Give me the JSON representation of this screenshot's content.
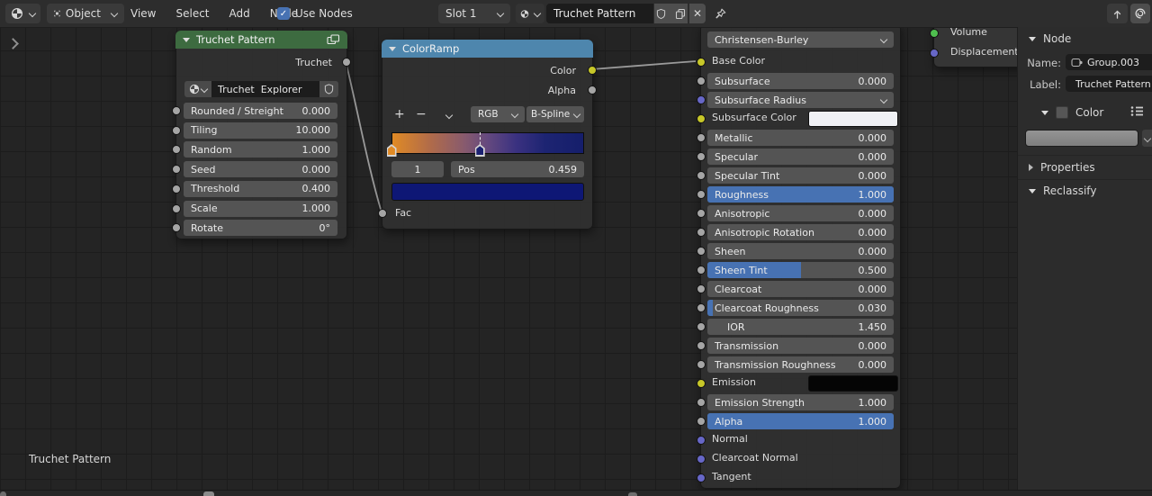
{
  "topbar": {
    "mode": "Object",
    "menus": [
      "View",
      "Select",
      "Add",
      "Node"
    ],
    "use_nodes": "Use Nodes",
    "slot": "Slot 1",
    "material_name": "Truchet Pattern"
  },
  "canvas": {
    "breadcrumb": "Truchet Pattern"
  },
  "truchet_node": {
    "title": "Truchet Pattern",
    "output": "Truchet",
    "datablock": "Truchet  Explorer",
    "params": [
      {
        "label": "Rounded / Streight",
        "value": "0.000"
      },
      {
        "label": "Tiling",
        "value": "10.000"
      },
      {
        "label": "Random",
        "value": "1.000"
      },
      {
        "label": "Seed",
        "value": "0.000"
      },
      {
        "label": "Threshold",
        "value": "0.400"
      },
      {
        "label": "Scale",
        "value": "1.000"
      },
      {
        "label": "Rotate",
        "value": "0°"
      }
    ]
  },
  "colorramp_node": {
    "title": "ColorRamp",
    "output_color": "Color",
    "output_alpha": "Alpha",
    "color_mode": "RGB",
    "interpolation": "B-Spline",
    "active_index": "1",
    "pos_label": "Pos",
    "pos_value": "0.459",
    "input": "Fac",
    "selected_swatch": "#0e1775",
    "gradient_css_stops": [
      "#e08a25 0%",
      "#b06b4a 20%",
      "#875a6e 38%",
      "#64497f 50%",
      "#3a3180 65%",
      "#1d2472 80%",
      "#151e6b 100%"
    ],
    "stops": [
      {
        "pos": 0.0,
        "color": "#e08a25",
        "selected": false
      },
      {
        "pos": 0.459,
        "color": "#1b2171",
        "selected": true
      }
    ]
  },
  "principled_node": {
    "rows": [
      {
        "type": "select",
        "label": "Christensen-Burley"
      },
      {
        "type": "label",
        "label": "Base Color",
        "socket": "yellow"
      },
      {
        "type": "slider",
        "label": "Subsurface",
        "value": "0.000",
        "fill": 0,
        "socket": "gray"
      },
      {
        "type": "select",
        "label": "Subsurface Radius",
        "socket": "vector"
      },
      {
        "type": "color",
        "label": "Subsurface Color",
        "swatch": "#f0f1f5",
        "socket": "yellow"
      },
      {
        "type": "slider",
        "label": "Metallic",
        "value": "0.000",
        "fill": 0,
        "socket": "gray"
      },
      {
        "type": "slider",
        "label": "Specular",
        "value": "0.000",
        "fill": 0,
        "socket": "gray"
      },
      {
        "type": "slider",
        "label": "Specular Tint",
        "value": "0.000",
        "fill": 0,
        "socket": "gray"
      },
      {
        "type": "slider",
        "label": "Roughness",
        "value": "1.000",
        "fill": 1,
        "socket": "gray"
      },
      {
        "type": "slider",
        "label": "Anisotropic",
        "value": "0.000",
        "fill": 0,
        "socket": "gray"
      },
      {
        "type": "slider",
        "label": "Anisotropic Rotation",
        "value": "0.000",
        "fill": 0,
        "socket": "gray"
      },
      {
        "type": "slider",
        "label": "Sheen",
        "value": "0.000",
        "fill": 0,
        "socket": "gray"
      },
      {
        "type": "slider",
        "label": "Sheen Tint",
        "value": "0.500",
        "fill": 0.5,
        "socket": "gray"
      },
      {
        "type": "slider",
        "label": "Clearcoat",
        "value": "0.000",
        "fill": 0,
        "socket": "gray"
      },
      {
        "type": "slider",
        "label": "Clearcoat Roughness",
        "value": "0.030",
        "fill": 0.03,
        "socket": "gray"
      },
      {
        "type": "number",
        "label": "IOR",
        "value": "1.450",
        "socket": "gray"
      },
      {
        "type": "slider",
        "label": "Transmission",
        "value": "0.000",
        "fill": 0,
        "socket": "gray"
      },
      {
        "type": "slider",
        "label": "Transmission Roughness",
        "value": "0.000",
        "fill": 0,
        "socket": "gray"
      },
      {
        "type": "color",
        "label": "Emission",
        "swatch": "#050505",
        "socket": "yellow"
      },
      {
        "type": "slider",
        "label": "Emission Strength",
        "value": "1.000",
        "fill": 0,
        "socket": "gray"
      },
      {
        "type": "slider",
        "label": "Alpha",
        "value": "1.000",
        "fill": 1,
        "socket": "gray"
      },
      {
        "type": "label",
        "label": "Normal",
        "socket": "vector"
      },
      {
        "type": "label",
        "label": "Clearcoat Normal",
        "socket": "vector"
      },
      {
        "type": "label",
        "label": "Tangent",
        "socket": "vector"
      }
    ]
  },
  "output_node": {
    "rows": [
      {
        "label": "Volume",
        "socket": "green"
      },
      {
        "label": "Displacement",
        "socket": "vector"
      }
    ]
  },
  "sidebar": {
    "panel_title": "Node",
    "name_label": "Name:",
    "name_value": "Group.003",
    "label_label": "Label:",
    "label_value": "Truchet Pattern",
    "color_panel_title": "Color",
    "properties_panel": "Properties",
    "reclassify_panel": "Reclassify"
  },
  "colors": {
    "accent_blue": "#4772b3",
    "header_green": "#3d6b40",
    "header_blue": "#4e86ad",
    "socket_gray": "#a5a5a5",
    "socket_yellow": "#c7c729",
    "socket_vector": "#6767c7",
    "socket_green": "#4fbf4f"
  }
}
